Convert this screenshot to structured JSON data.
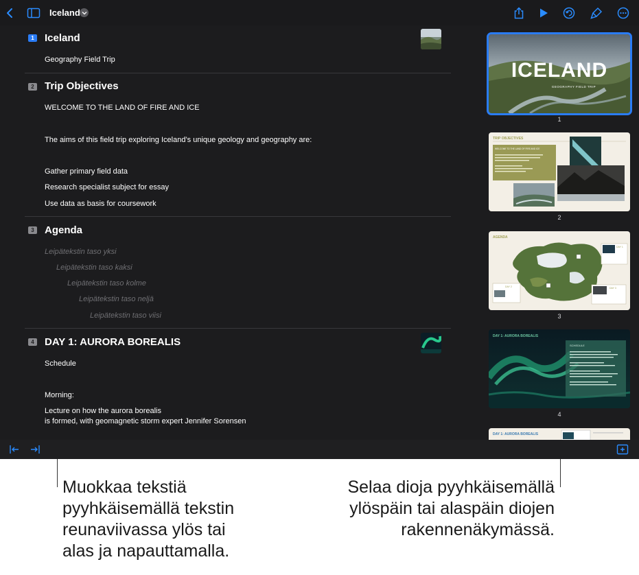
{
  "toolbar": {
    "title": "Iceland",
    "icons": [
      "back-chevron-icon",
      "sidebar-icon",
      "chevron-down-icon",
      "share-icon",
      "play-icon",
      "undo-icon",
      "format-brush-icon",
      "more-icon"
    ]
  },
  "outline": {
    "slides": [
      {
        "number": "1",
        "title": "Iceland",
        "lines": [
          "Geography Field Trip"
        ]
      },
      {
        "number": "2",
        "title": "Trip Objectives",
        "lines": [
          "WELCOME TO THE LAND OF FIRE AND ICE",
          "The aims of this field trip exploring Iceland’s unique geology and geography are:",
          "Gather primary field data",
          "Research specialist subject for essay",
          "Use data as basis for coursework"
        ]
      },
      {
        "number": "3",
        "title": "Agenda",
        "placeholders": [
          "Leipätekstin taso yksi",
          "Leipätekstin taso kaksi",
          "Leipätekstin taso kolme",
          "Leipätekstin taso neljä",
          "Leipätekstin taso viisi"
        ]
      },
      {
        "number": "4",
        "title": "DAY 1: AURORA BOREALIS",
        "lines": [
          "Schedule",
          "Morning:",
          "Lecture on how the aurora borealis",
          "is formed, with geomagnetic storm expert Jennifer Sorensen"
        ]
      }
    ]
  },
  "navigator": {
    "thumb1": {
      "label": "1",
      "title": "ICELAND",
      "subtitle": "GEOGRAPHY FIELD TRIP"
    },
    "thumb2": {
      "label": "2",
      "title": "TRIP OBJECTIVES",
      "box_title": "WELCOME TO THE LAND OF FIRE AND ICE"
    },
    "thumb3": {
      "label": "3",
      "title": "AGENDA",
      "day1": "DAY 1",
      "day2": "DAY 2",
      "day3": "DAY 3"
    },
    "thumb4": {
      "label": "4",
      "title": "DAY 1: AURORA BOREALIS",
      "box_title": "SCHEDULE"
    },
    "thumb5": {
      "title": "DAY 1: AURORA BOREALIS"
    }
  },
  "bottombar": {
    "icons": [
      "outdent-icon",
      "indent-icon",
      "add-slide-icon"
    ]
  },
  "callouts": {
    "left": [
      "Muokkaa tekstiä",
      "pyyhkäisemällä tekstin",
      "reunaviivassa ylös tai",
      "alas ja napauttamalla."
    ],
    "right": [
      "Selaa dioja pyyhkäisemällä",
      "ylöspäin tai alaspäin diojen",
      "rakennenäkymässä."
    ]
  },
  "colors": {
    "accent": "#2a7cf6",
    "background": "#1c1c1e"
  }
}
